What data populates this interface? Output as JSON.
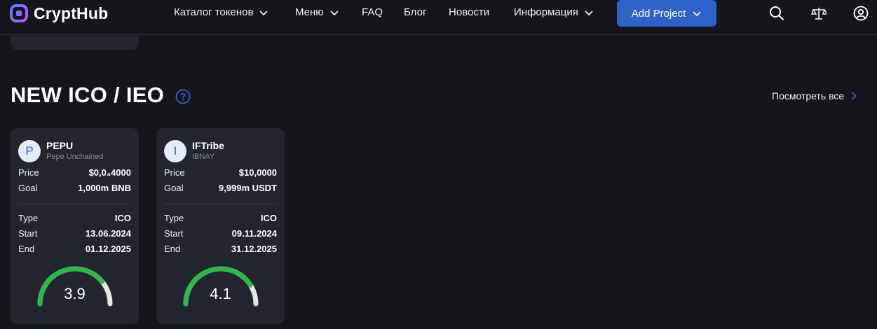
{
  "header": {
    "logo_text": "CryptHub",
    "nav": [
      {
        "label": "Каталог токенов",
        "has_dropdown": true
      },
      {
        "label": "Меню",
        "has_dropdown": true
      },
      {
        "label": "FAQ",
        "has_dropdown": false
      },
      {
        "label": "Блог",
        "has_dropdown": false
      },
      {
        "label": "Новости",
        "has_dropdown": false
      },
      {
        "label": "Информация",
        "has_dropdown": true
      }
    ],
    "add_project_label": "Add Project",
    "icons": [
      "search-icon",
      "scales-icon",
      "user-icon"
    ]
  },
  "section": {
    "title": "NEW ICO / IEO",
    "see_all_label": "Посмотреть все"
  },
  "cards": [
    {
      "avatar_letter": "P",
      "ticker": "PEPU",
      "name": "Pepe Unchained",
      "price_label": "Price",
      "price": "$0,0₄4000",
      "goal_label": "Goal",
      "goal": "1,000m BNB",
      "type_label": "Type",
      "type": "ICO",
      "start_label": "Start",
      "start": "13.06.2024",
      "end_label": "End",
      "end": "01.12.2025",
      "score": "3.9",
      "score_fraction": 0.78
    },
    {
      "avatar_letter": "I",
      "ticker": "IFTribe",
      "name": "IBNAY",
      "price_label": "Price",
      "price": "$10,0000",
      "goal_label": "Goal",
      "goal": "9,999m USDT",
      "type_label": "Type",
      "type": "ICO",
      "start_label": "Start",
      "start": "09.11.2024",
      "end_label": "End",
      "end": "31.12.2025",
      "score": "4.1",
      "score_fraction": 0.82
    }
  ],
  "colors": {
    "background": "#15161b",
    "card": "#23252f",
    "accent": "#2d63c8",
    "gauge_fill": "#2db84d",
    "gauge_track": "#e6e6e6"
  }
}
